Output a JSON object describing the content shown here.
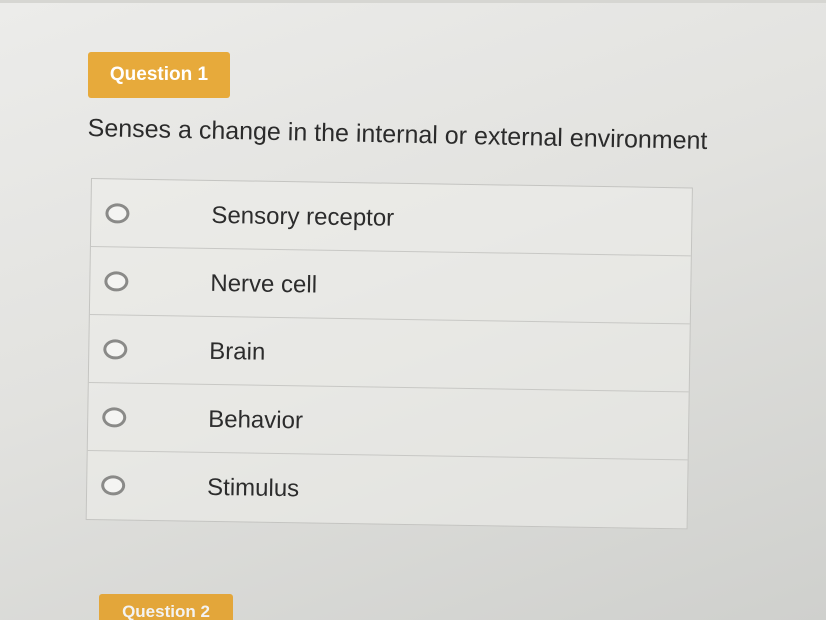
{
  "question": {
    "badge": "Question 1",
    "prompt": "Senses a change in the internal or external environment"
  },
  "answers": [
    {
      "label": "Sensory receptor",
      "selected": false
    },
    {
      "label": "Nerve cell",
      "selected": false
    },
    {
      "label": "Brain",
      "selected": false
    },
    {
      "label": "Behavior",
      "selected": false
    },
    {
      "label": "Stimulus",
      "selected": false
    }
  ],
  "next_question": {
    "badge": "Question 2"
  },
  "colors": {
    "badge": "#e7aa3b",
    "text": "#2b2b2b",
    "border": "#c4c4c1"
  }
}
